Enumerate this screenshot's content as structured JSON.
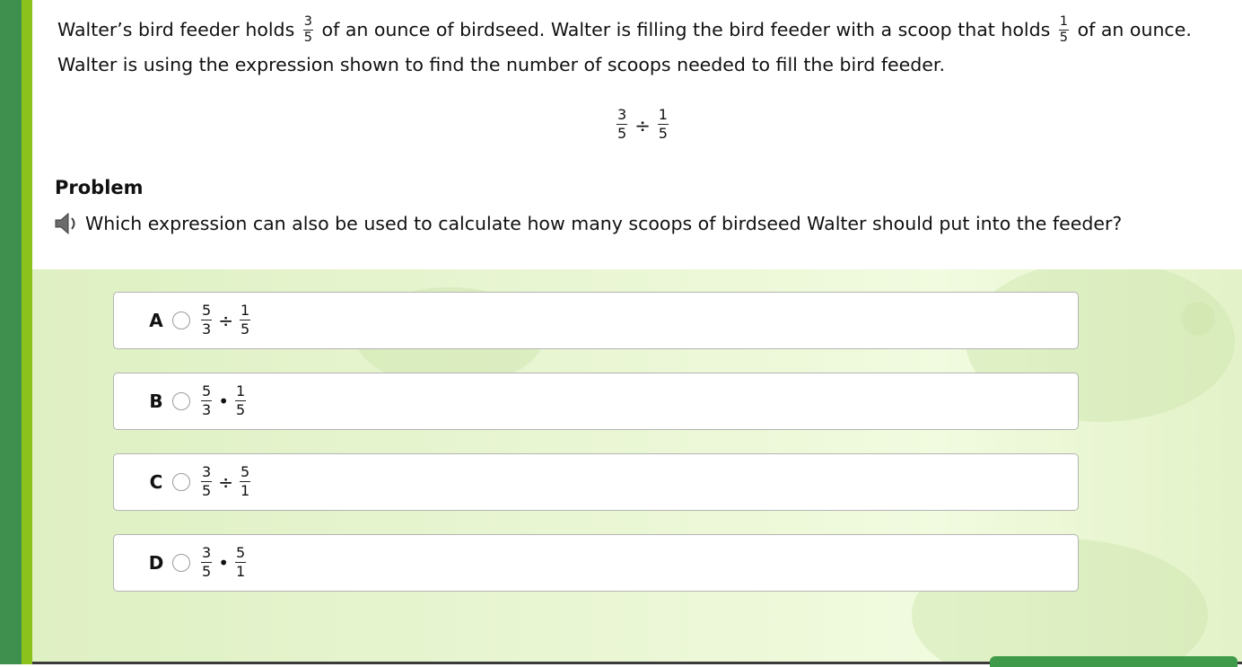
{
  "stem": {
    "part1": "Walter’s bird feeder holds",
    "frac1": {
      "num": "3",
      "den": "5"
    },
    "part2": "of an ounce of birdseed. Walter is filling the bird feeder with a scoop that holds",
    "frac2": {
      "num": "1",
      "den": "5"
    },
    "part3": "of an ounce. Walter is using the expression shown to find the number of scoops needed to fill the bird feeder."
  },
  "expression": {
    "left": {
      "num": "3",
      "den": "5"
    },
    "operator": "÷",
    "right": {
      "num": "1",
      "den": "5"
    }
  },
  "problem": {
    "heading": "Problem",
    "question": "Which expression can also be used to calculate how many scoops of birdseed Walter should put into the feeder?",
    "speaker_icon": "speaker-icon"
  },
  "choices": [
    {
      "letter": "A",
      "left": {
        "num": "5",
        "den": "3"
      },
      "operator": "÷",
      "right": {
        "num": "1",
        "den": "5"
      }
    },
    {
      "letter": "B",
      "left": {
        "num": "5",
        "den": "3"
      },
      "operator": "•",
      "right": {
        "num": "1",
        "den": "5"
      }
    },
    {
      "letter": "C",
      "left": {
        "num": "3",
        "den": "5"
      },
      "operator": "÷",
      "right": {
        "num": "5",
        "den": "1"
      }
    },
    {
      "letter": "D",
      "left": {
        "num": "3",
        "den": "5"
      },
      "operator": "•",
      "right": {
        "num": "5",
        "den": "1"
      }
    }
  ],
  "colors": {
    "sidebar_dark": "#3f8f4f",
    "sidebar_light": "#8cc21c",
    "answer_background": "#e9f6d3",
    "button_green": "#3f9a4a"
  }
}
